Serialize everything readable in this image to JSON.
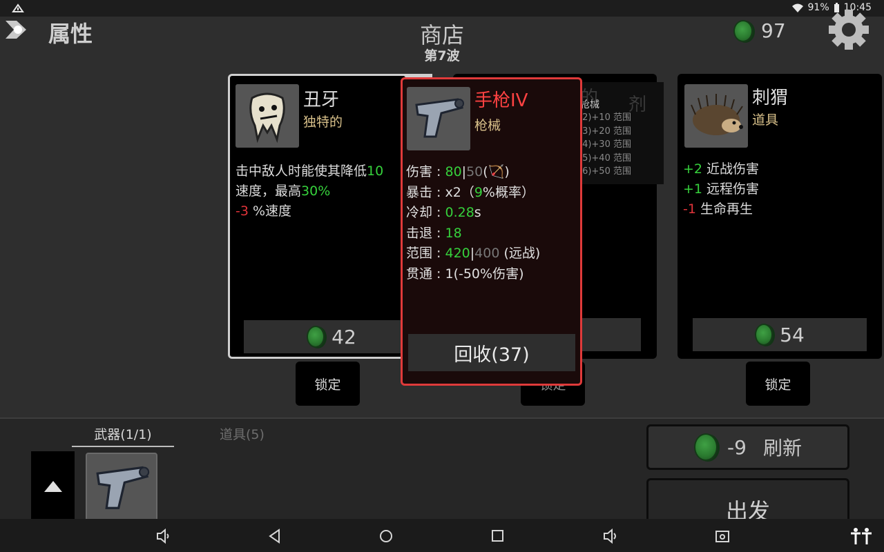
{
  "status_bar": {
    "battery": "91%",
    "time": "10:45"
  },
  "header": {
    "attributes_label": "属性",
    "shop_title": "商店",
    "wave_label": "第7波",
    "coins": "97"
  },
  "cards": [
    {
      "name": "丑牙",
      "type": "独特的",
      "desc": [
        [
          {
            "t": "击中敌人时能使其降低"
          },
          {
            "t": "10",
            "c": "g"
          }
        ],
        [
          {
            "t": "速度，最高"
          },
          {
            "t": "30%",
            "c": "g"
          }
        ],
        [
          {
            "t": "-3",
            "c": "r"
          },
          {
            "t": " %速度"
          }
        ]
      ],
      "price": "42",
      "lock_label": "锁定"
    },
    {
      "name_partial": "的",
      "name_partial2": "剂",
      "type": "枪械",
      "tiers": [
        "(2)+10 范围",
        "(3)+20 范围",
        "(4)+30 范围",
        "(5)+40 范围",
        "(6)+50 范围"
      ],
      "lock_label": "锁定"
    },
    {
      "name": "刺猬",
      "type": "道具",
      "desc": [
        [
          {
            "t": "+2",
            "c": "g"
          },
          {
            "t": " 近战伤害"
          }
        ],
        [
          {
            "t": "+1",
            "c": "g"
          },
          {
            "t": " 远程伤害"
          }
        ],
        [
          {
            "t": "-1",
            "c": "r"
          },
          {
            "t": " 生命再生"
          }
        ]
      ],
      "price": "54",
      "lock_label": "锁定"
    }
  ],
  "tooltip": {
    "name": "手枪IV",
    "type": "枪械",
    "stats": [
      [
        {
          "t": "伤害 : "
        },
        {
          "t": "80",
          "c": "g"
        },
        {
          "t": "|"
        },
        {
          "t": "50",
          "c": "gy"
        },
        {
          "t": "("
        },
        {
          "t": "🏹",
          "c": "bow"
        },
        {
          "t": ")"
        }
      ],
      [
        {
          "t": "暴击 :  x2（"
        },
        {
          "t": "9",
          "c": "g"
        },
        {
          "t": "%概率）"
        }
      ],
      [
        {
          "t": "冷却 : "
        },
        {
          "t": "0.28",
          "c": "g"
        },
        {
          "t": "s"
        }
      ],
      [
        {
          "t": "击退 : "
        },
        {
          "t": "18",
          "c": "g"
        }
      ],
      [
        {
          "t": "范围 : "
        },
        {
          "t": "420",
          "c": "g"
        },
        {
          "t": "|"
        },
        {
          "t": "400",
          "c": "gy"
        },
        {
          "t": " (远战)"
        }
      ],
      [
        {
          "t": "贯通 : 1(-50%伤害)"
        }
      ]
    ],
    "recycle_label": "回收(37)"
  },
  "inventory": {
    "weapons_tab": "武器(1/1)",
    "items_tab": "道具(5)"
  },
  "actions": {
    "refresh_cost": "-9",
    "refresh_label": "刷新",
    "go_label": "出发"
  },
  "colors": {
    "positive": "#36d13c",
    "negative": "#e0343a",
    "legendary": "#e03a3a",
    "type_text": "#d8c08a"
  }
}
